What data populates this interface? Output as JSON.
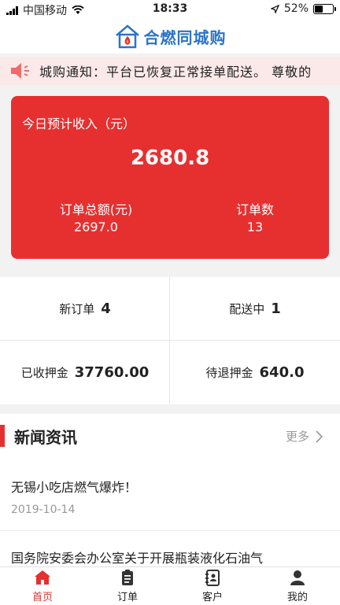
{
  "status_bar": {
    "carrier": "中国移动",
    "time": "18:33",
    "battery": "52%",
    "battery_level": 0.52
  },
  "header": {
    "app_name": "合燃同城购"
  },
  "notice": {
    "text": "城购通知：平台已恢复正常接单配送。 尊敬的"
  },
  "income_card": {
    "title": "今日预计收入（元）",
    "amount": "2680.8",
    "total_label": "订单总额(元)",
    "total_value": "2697.0",
    "count_label": "订单数",
    "count_value": "13"
  },
  "stats": {
    "new_orders": {
      "label": "新订单",
      "value": "4"
    },
    "delivering": {
      "label": "配送中",
      "value": "1"
    },
    "deposit_received": {
      "label": "已收押金",
      "value": "37760.00"
    },
    "deposit_refund": {
      "label": "待退押金",
      "value": "640.0"
    }
  },
  "news": {
    "title": "新闻资讯",
    "more": "更多",
    "items": [
      {
        "title": "无锡小吃店燃气爆炸！",
        "date": "2019-10-14"
      },
      {
        "title": "国务院安委会办公室关于开展瓶装液化石油气"
      }
    ]
  },
  "tabbar": {
    "tabs": [
      {
        "label": "首页",
        "icon": "home-icon"
      },
      {
        "label": "订单",
        "icon": "clipboard-icon"
      },
      {
        "label": "客户",
        "icon": "contacts-icon"
      },
      {
        "label": "我的",
        "icon": "user-icon"
      }
    ]
  },
  "colors": {
    "accent": "#e63030",
    "brand_blue": "#2b73c7",
    "notice_bg": "#fbe9e9"
  }
}
